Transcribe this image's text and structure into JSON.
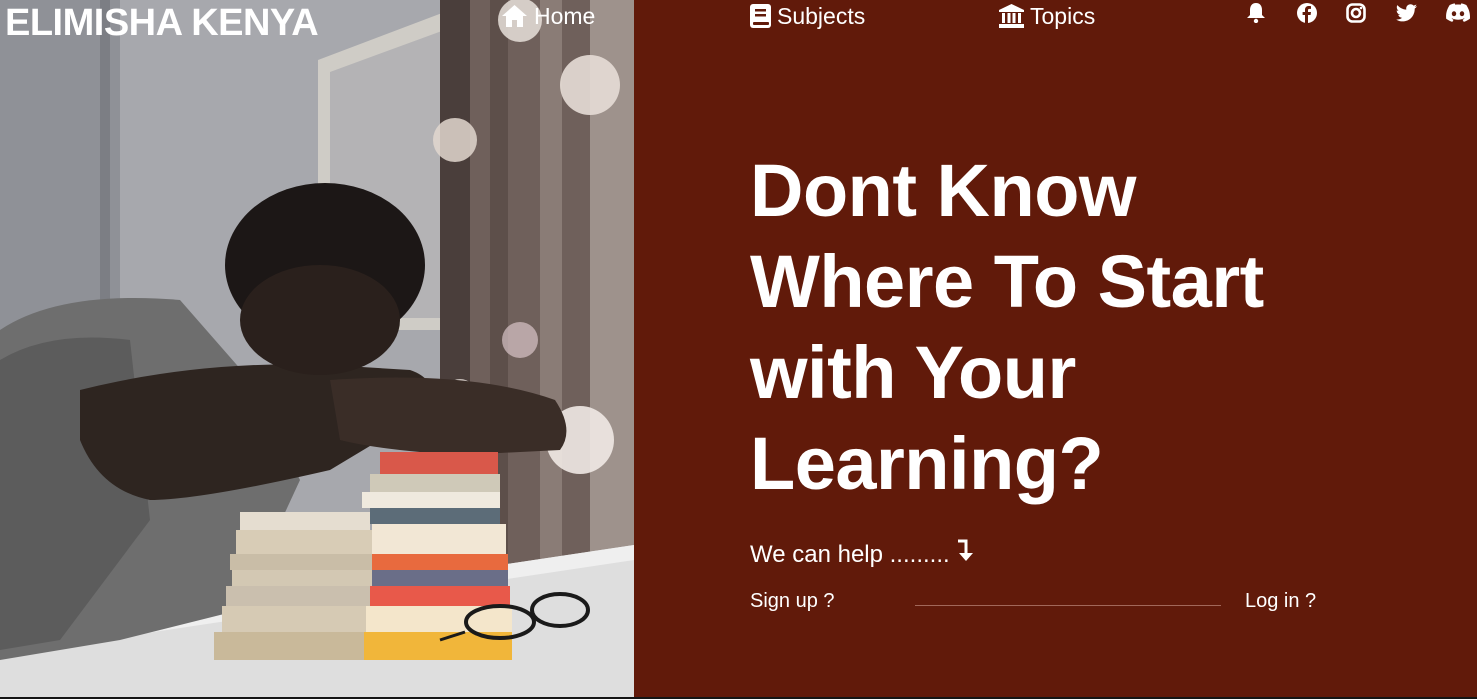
{
  "brand": {
    "name": "ELIMISHA KENYA"
  },
  "nav": {
    "items": [
      {
        "label": "Home",
        "icon": "home-icon"
      },
      {
        "label": "Subjects",
        "icon": "book-icon"
      },
      {
        "label": "Topics",
        "icon": "institution-icon"
      }
    ],
    "social_icons": [
      "bell-icon",
      "facebook-icon",
      "instagram-icon",
      "twitter-icon",
      "discord-icon"
    ]
  },
  "hero": {
    "title": "Dont Know Where To Start with Your Learning?",
    "help_text": "We can help .........",
    "help_icon": "arrow-down-turn-icon",
    "signup_label": "Sign up ?",
    "login_label": "Log in ?"
  },
  "colors": {
    "background": "#611a0a",
    "text": "#ffffff",
    "divider": "#a2685a"
  },
  "hero_image": {
    "alt": "Student resting head on a stack of books"
  }
}
